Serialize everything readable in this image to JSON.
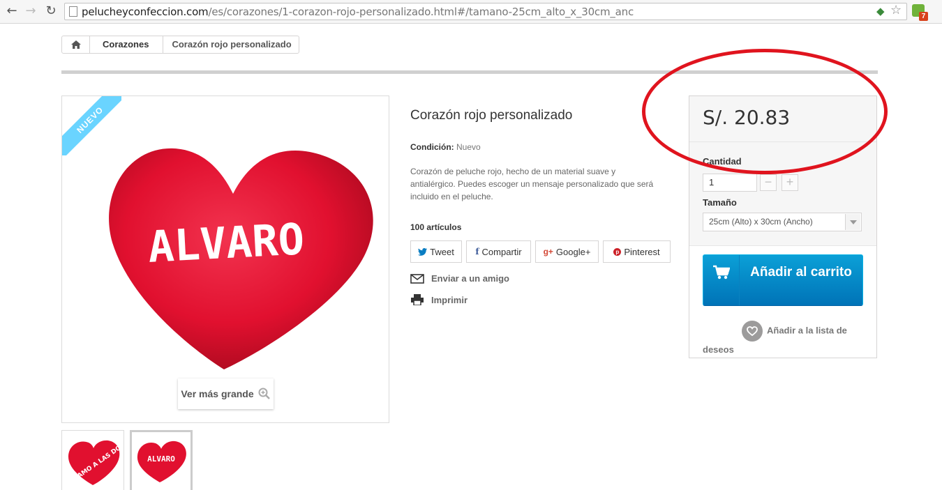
{
  "browser": {
    "url_host": "pelucheyconfeccion.com",
    "url_path": "/es/corazones/1-corazon-rojo-personalizado.html#/tamano-25cm_alto_x_30cm_anc",
    "extension_badge": "7"
  },
  "breadcrumb": {
    "items": [
      "Corazones"
    ],
    "current": "Corazón rojo personalizado"
  },
  "product": {
    "badge": "NUEVO",
    "heart_text": "ALVARO",
    "zoom_label": "Ver más grande",
    "title": "Corazón rojo personalizado",
    "condition_label": "Condición:",
    "condition_value": "Nuevo",
    "description": "Corazón de peluche rojo, hecho de un material suave y antialérgico. Puedes escoger un mensaje personalizado que será incluido en el peluche.",
    "stock": "100 artículos",
    "thumbs": [
      {
        "text": "LAS AMO A LAS DOS"
      },
      {
        "text": "ALVARO"
      }
    ]
  },
  "social": [
    {
      "label": "Tweet",
      "icon": "twitter-icon"
    },
    {
      "label": "Compartir",
      "icon": "facebook-icon"
    },
    {
      "label": "Google+",
      "icon": "googleplus-icon"
    },
    {
      "label": "Pinterest",
      "icon": "pinterest-icon"
    }
  ],
  "links": {
    "send_friend": "Enviar a un amigo",
    "print": "Imprimir"
  },
  "buybox": {
    "price": "S/. 20.83",
    "qty_label": "Cantidad",
    "qty_value": "1",
    "minus": "−",
    "plus": "+",
    "size_label": "Tamaño",
    "size_value": "25cm (Alto) x 30cm (Ancho)",
    "cart_label": "Añadir al carrito",
    "wishlist_label_a": "Añadir a la lista de",
    "wishlist_label_b": "deseos"
  },
  "colors": {
    "accent_blue": "#0ba0d7",
    "annotation_red": "#e0141e",
    "ribbon": "#6ad4ff"
  }
}
